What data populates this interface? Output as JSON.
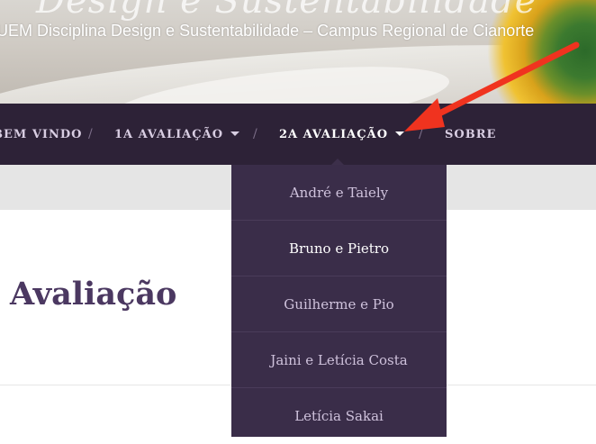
{
  "header": {
    "site_title": "Design e Sustentabilidade",
    "tagline": "UEM Disciplina Design e Sustentabilidade – Campus Regional de Cianorte"
  },
  "nav": {
    "items": [
      {
        "label": "BEM VINDO",
        "has_caret": false
      },
      {
        "label": "1A AVALIAÇÃO",
        "has_caret": true
      },
      {
        "label": "2A AVALIAÇÃO",
        "has_caret": true,
        "active": true
      },
      {
        "label": "SOBRE",
        "has_caret": false
      }
    ],
    "separator": "/"
  },
  "dropdown": {
    "items": [
      {
        "label": "André e Taiely"
      },
      {
        "label": "Bruno e Pietro",
        "hovered": true
      },
      {
        "label": "Guilherme e Pio"
      },
      {
        "label": "Jaini e Letícia Costa"
      },
      {
        "label": "Letícia Sakai"
      }
    ]
  },
  "page": {
    "title": "Avaliação"
  },
  "colors": {
    "nav_bg": "#2d2237",
    "dropdown_bg": "#3a2d49",
    "title": "#4b3861",
    "annotation_arrow": "#f0331f"
  },
  "icons": {
    "caret": "caret-down-icon",
    "annotation": "red-arrow-annotation"
  }
}
